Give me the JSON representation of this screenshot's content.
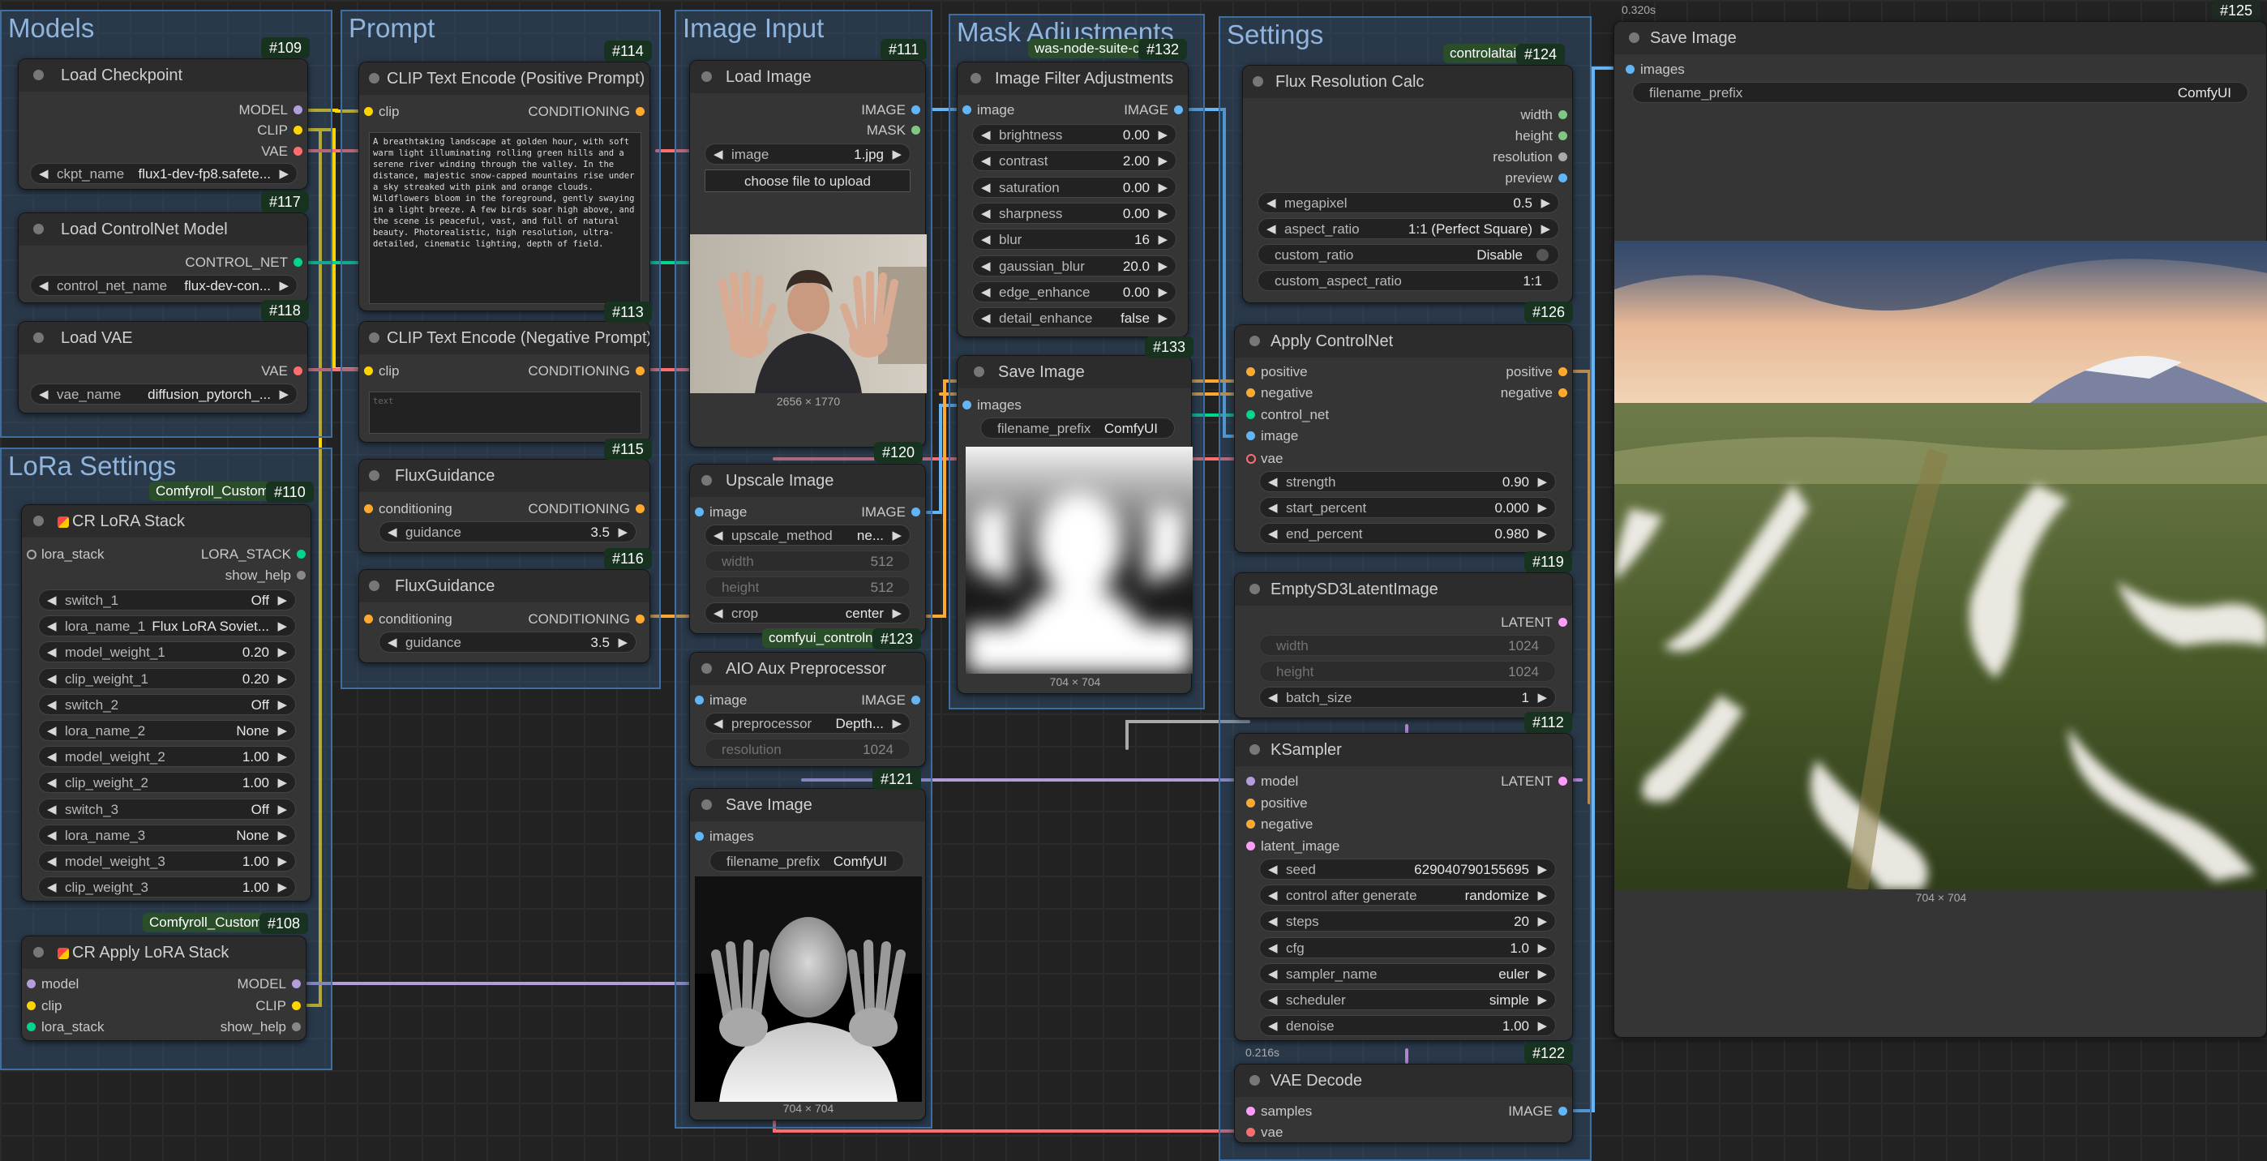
{
  "colors": {
    "model": "#b39ddb",
    "clip": "#ffd500",
    "vae": "#ff6e6e",
    "conditioning": "#ffa931",
    "control_net": "#00d78d",
    "image": "#64b5f6",
    "latent": "#ff9cf9",
    "mask": "#81c784",
    "lora_stack": "#aaaaaa",
    "float": "#aaaaaa"
  },
  "groups": {
    "models": "Models",
    "prompt": "Prompt",
    "image_input": "Image Input",
    "mask_adjustments": "Mask Adjustments",
    "settings": "Settings",
    "lora_settings": "LoRa Settings"
  },
  "nodes": {
    "load_checkpoint": {
      "id": "#109",
      "title": "Load Checkpoint",
      "outputs": [
        "MODEL",
        "CLIP",
        "VAE"
      ],
      "widget": {
        "label": "ckpt_name",
        "value": "flux1-dev-fp8.safete..."
      }
    },
    "load_controlnet": {
      "id": "#117",
      "title": "Load ControlNet Model",
      "output": "CONTROL_NET",
      "widget": {
        "label": "control_net_name",
        "value": "flux-dev-con..."
      }
    },
    "load_vae": {
      "id": "#118",
      "title": "Load VAE",
      "output": "VAE",
      "widget": {
        "label": "vae_name",
        "value": "diffusion_pytorch_..."
      }
    },
    "clip_pos": {
      "id": "#114",
      "title": "CLIP Text Encode (Positive Prompt)",
      "input": "clip",
      "output": "CONDITIONING",
      "text": "A breathtaking landscape at golden hour, with soft warm light illuminating rolling green hills and a serene river winding through the valley. In the distance, majestic snow-capped mountains rise under a sky streaked with pink and orange clouds. Wildflowers bloom in the foreground, gently swaying in a light breeze. A few birds soar high above, and the scene is peaceful, vast, and full of natural beauty. Photorealistic, high resolution, ultra-detailed, cinematic lighting, depth of field."
    },
    "clip_neg": {
      "id": "#113",
      "title": "CLIP Text Encode (Negative Prompt)",
      "input": "clip",
      "output": "CONDITIONING",
      "placeholder": "text"
    },
    "flux_guidance_1": {
      "id": "#115",
      "title": "FluxGuidance",
      "input": "conditioning",
      "output": "CONDITIONING",
      "widget": {
        "label": "guidance",
        "value": "3.5"
      }
    },
    "flux_guidance_2": {
      "id": "#116",
      "title": "FluxGuidance",
      "input": "conditioning",
      "output": "CONDITIONING",
      "widget": {
        "label": "guidance",
        "value": "3.5"
      }
    },
    "load_image": {
      "id": "#111",
      "title": "Load Image",
      "outputs": [
        "IMAGE",
        "MASK"
      ],
      "widget": {
        "label": "image",
        "value": "1.jpg"
      },
      "button": "choose file to upload",
      "caption": "2656 × 1770"
    },
    "upscale_image": {
      "id": "#120",
      "title": "Upscale Image",
      "input": "image",
      "output": "IMAGE",
      "widgets": [
        {
          "label": "upscale_method",
          "value": "ne..."
        },
        {
          "label": "width",
          "value": "512"
        },
        {
          "label": "height",
          "value": "512"
        },
        {
          "label": "crop",
          "value": "center"
        }
      ]
    },
    "aio_aux": {
      "id": "#123",
      "pack": "comfyui_controlnet",
      "title": "AIO Aux Preprocessor",
      "input": "image",
      "output": "IMAGE",
      "widgets": [
        {
          "label": "preprocessor",
          "value": "Depth..."
        },
        {
          "label": "resolution",
          "value": "1024"
        }
      ]
    },
    "save_image_121": {
      "id": "#121",
      "title": "Save Image",
      "input": "images",
      "widget": {
        "label": "filename_prefix",
        "value": "ComfyUI"
      },
      "caption": "704 × 704"
    },
    "image_filter": {
      "id": "#132",
      "pack": "was-node-suite-co",
      "title": "Image Filter Adjustments",
      "input": "image",
      "output": "IMAGE",
      "widgets": [
        {
          "label": "brightness",
          "value": "0.00"
        },
        {
          "label": "contrast",
          "value": "2.00"
        },
        {
          "label": "saturation",
          "value": "0.00"
        },
        {
          "label": "sharpness",
          "value": "0.00"
        },
        {
          "label": "blur",
          "value": "16"
        },
        {
          "label": "gaussian_blur",
          "value": "20.0"
        },
        {
          "label": "edge_enhance",
          "value": "0.00"
        },
        {
          "label": "detail_enhance",
          "value": "false"
        }
      ]
    },
    "save_image_133": {
      "id": "#133",
      "title": "Save Image",
      "input": "images",
      "widget": {
        "label": "filename_prefix",
        "value": "ComfyUI"
      },
      "caption": "704 × 704"
    },
    "flux_res": {
      "id": "#124",
      "pack": "controlaltai-",
      "title": "Flux Resolution Calc",
      "outputs": [
        "width",
        "height",
        "resolution",
        "preview"
      ],
      "widgets": [
        {
          "label": "megapixel",
          "value": "0.5"
        },
        {
          "label": "aspect_ratio",
          "value": "1:1 (Perfect Square)"
        },
        {
          "label": "custom_ratio",
          "value": "Disable"
        },
        {
          "label": "custom_aspect_ratio",
          "value": "1:1"
        }
      ]
    },
    "apply_controlnet": {
      "id": "#126",
      "title": "Apply ControlNet",
      "inputs": [
        "positive",
        "negative",
        "control_net",
        "image",
        "vae"
      ],
      "outputs": [
        "positive",
        "negative"
      ],
      "widgets": [
        {
          "label": "strength",
          "value": "0.90"
        },
        {
          "label": "start_percent",
          "value": "0.000"
        },
        {
          "label": "end_percent",
          "value": "0.980"
        }
      ]
    },
    "empty_latent": {
      "id": "#119",
      "title": "EmptySD3LatentImage",
      "output": "LATENT",
      "widgets": [
        {
          "label": "width",
          "value": "1024"
        },
        {
          "label": "height",
          "value": "1024"
        },
        {
          "label": "batch_size",
          "value": "1"
        }
      ]
    },
    "ksampler": {
      "id": "#112",
      "title": "KSampler",
      "inputs": [
        "model",
        "positive",
        "negative",
        "latent_image"
      ],
      "output": "LATENT",
      "widgets": [
        {
          "label": "seed",
          "value": "629040790155695"
        },
        {
          "label": "control after generate",
          "value": "randomize"
        },
        {
          "label": "steps",
          "value": "20"
        },
        {
          "label": "cfg",
          "value": "1.0"
        },
        {
          "label": "sampler_name",
          "value": "euler"
        },
        {
          "label": "scheduler",
          "value": "simple"
        },
        {
          "label": "denoise",
          "value": "1.00"
        }
      ],
      "timing": "0.216s"
    },
    "vae_decode": {
      "id": "#122",
      "title": "VAE Decode",
      "inputs": [
        "samples",
        "vae"
      ],
      "output": "IMAGE"
    },
    "save_image_125": {
      "id": "#125",
      "title": "Save Image",
      "input": "images",
      "widget": {
        "label": "filename_prefix",
        "value": "ComfyUI"
      },
      "caption": "704 × 704",
      "timing": "0.320s"
    },
    "cr_lora_stack": {
      "id": "#110",
      "pack": "Comfyroll_CustomN",
      "title": "CR LoRA Stack",
      "input": "lora_stack",
      "outputs": [
        "LORA_STACK",
        "show_help"
      ],
      "widgets": [
        {
          "label": "switch_1",
          "value": "Off"
        },
        {
          "label": "lora_name_1",
          "value": "Flux LoRA Soviet..."
        },
        {
          "label": "model_weight_1",
          "value": "0.20"
        },
        {
          "label": "clip_weight_1",
          "value": "0.20"
        },
        {
          "label": "switch_2",
          "value": "Off"
        },
        {
          "label": "lora_name_2",
          "value": "None"
        },
        {
          "label": "model_weight_2",
          "value": "1.00"
        },
        {
          "label": "clip_weight_2",
          "value": "1.00"
        },
        {
          "label": "switch_3",
          "value": "Off"
        },
        {
          "label": "lora_name_3",
          "value": "None"
        },
        {
          "label": "model_weight_3",
          "value": "1.00"
        },
        {
          "label": "clip_weight_3",
          "value": "1.00"
        }
      ]
    },
    "cr_apply_lora": {
      "id": "#108",
      "pack": "Comfyroll_CustomN",
      "title": "CR Apply LoRA Stack",
      "inputs": [
        "model",
        "clip",
        "lora_stack"
      ],
      "outputs": [
        "MODEL",
        "CLIP",
        "show_help"
      ]
    }
  }
}
